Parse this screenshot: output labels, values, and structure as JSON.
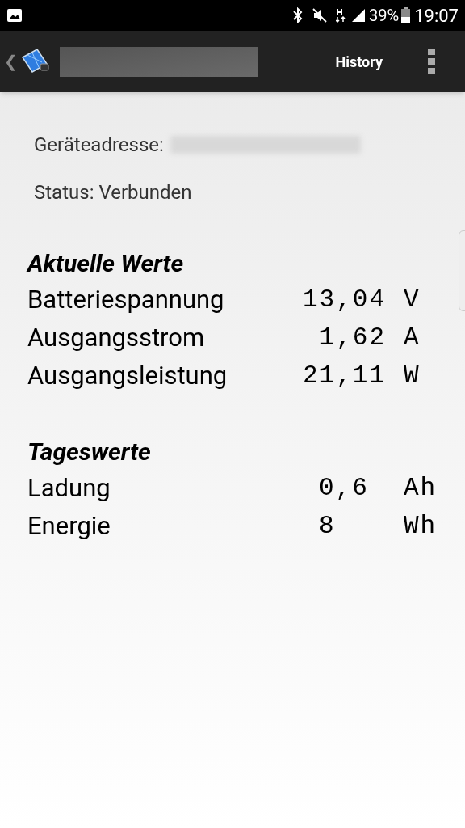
{
  "status_bar": {
    "battery": "39%",
    "time": "19:07"
  },
  "toolbar": {
    "back": "❮",
    "history": "History"
  },
  "device": {
    "address_label": "Geräteadresse:",
    "status": "Status: Verbunden"
  },
  "sections": [
    {
      "title": "Aktuelle Werte",
      "rows": [
        {
          "label": "Batteriespannung",
          "value": "13,04",
          "unit": "V"
        },
        {
          "label": "Ausgangsstrom",
          "value": "1,62",
          "unit": "A"
        },
        {
          "label": "Ausgangsleistung",
          "value": "21,11",
          "unit": "W"
        }
      ]
    },
    {
      "title": "Tageswerte",
      "rows": [
        {
          "label": "Ladung",
          "value": "0,6",
          "unit": "Ah"
        },
        {
          "label": "Energie",
          "value": "8",
          "unit": "Wh"
        }
      ]
    }
  ]
}
